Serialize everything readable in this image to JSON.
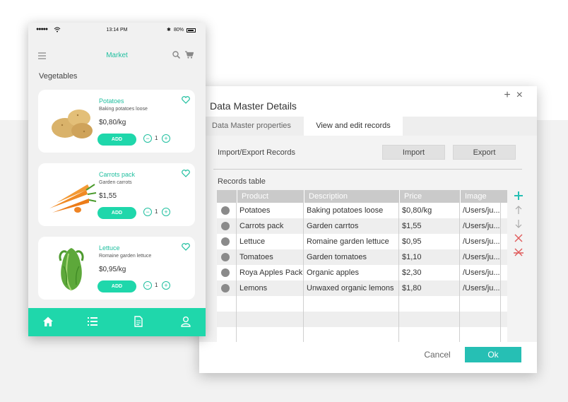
{
  "colors": {
    "accent": "#1fd7ab",
    "accent_text": "#1fbf9f",
    "dialog_ok": "#26bfb4",
    "remove_red": "#e05a5a"
  },
  "dialog": {
    "title": "Data Master Details",
    "controls": {
      "add": "+",
      "close": "×"
    },
    "tabs": [
      {
        "label": "Data Master properties",
        "active": false
      },
      {
        "label": "View and edit records",
        "active": true
      }
    ],
    "import_export": {
      "label": "Import/Export Records",
      "import_label": "Import",
      "export_label": "Export"
    },
    "records_label": "Records table",
    "table": {
      "columns": [
        "Product",
        "Description",
        "Price",
        "Image"
      ],
      "rows": [
        {
          "product": "Potatoes",
          "description": "Baking potatoes loose",
          "price": "$0,80/kg",
          "image": "/Users/ju..."
        },
        {
          "product": "Carrots pack",
          "description": "Garden carrtos",
          "price": "$1,55",
          "image": "/Users/ju..."
        },
        {
          "product": "Lettuce",
          "description": "Romaine garden lettuce",
          "price": "$0,95",
          "image": "/Users/ju..."
        },
        {
          "product": "Tomatoes",
          "description": "Garden tomatoes",
          "price": "$1,10",
          "image": "/Users/ju..."
        },
        {
          "product": "Roya Apples Pack",
          "description": "Organic apples",
          "price": "$2,30",
          "image": "/Users/ju..."
        },
        {
          "product": "Lemons",
          "description": "Unwaxed organic lemons",
          "price": "$1,80",
          "image": "/Users/ju..."
        }
      ]
    },
    "side_tools": [
      "add-row-icon",
      "move-up-icon",
      "move-down-icon",
      "delete-row-icon",
      "delete-all-icon"
    ],
    "cancel_label": "Cancel",
    "ok_label": "Ok"
  },
  "phone": {
    "status": {
      "time": "13:14 PM",
      "battery": "80%"
    },
    "app_title": "Market",
    "section_title": "Vegetables",
    "products": [
      {
        "name": "Potatoes",
        "description": "Baking potatoes loose",
        "price": "$0,80/kg",
        "add_label": "ADD",
        "quantity": "1",
        "image_icon": "potatoes-image"
      },
      {
        "name": "Carrots pack",
        "description": "Garden carrots",
        "price": "$1,55",
        "add_label": "ADD",
        "quantity": "1",
        "image_icon": "carrots-image"
      },
      {
        "name": "Lettuce",
        "description": "Romaine garden lettuce",
        "price": "$0,95/kg",
        "add_label": "ADD",
        "quantity": "1",
        "image_icon": "lettuce-image"
      }
    ],
    "nav_icons": [
      "home-icon",
      "list-icon",
      "document-icon",
      "user-icon"
    ]
  }
}
